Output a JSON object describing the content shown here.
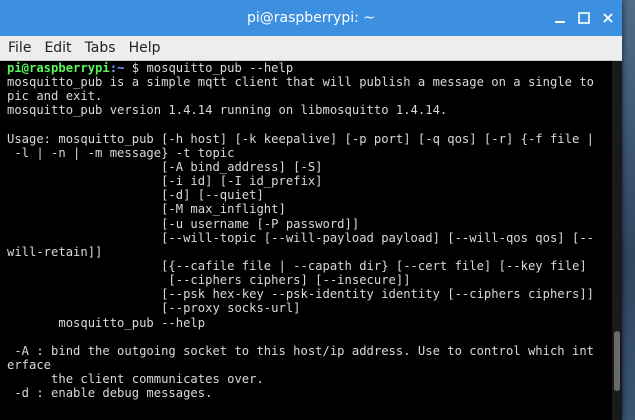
{
  "window": {
    "title": "pi@raspberrypi: ~"
  },
  "menu": {
    "items": [
      "File",
      "Edit",
      "Tabs",
      "Help"
    ]
  },
  "terminal": {
    "prompt": {
      "user_host": "pi@raspberrypi",
      "path": ":~",
      "symbol": " $ ",
      "command": "mosquitto_pub --help"
    },
    "lines": [
      "mosquitto_pub is a simple mqtt client that will publish a message on a single to",
      "pic and exit.",
      "mosquitto_pub version 1.4.14 running on libmosquitto 1.4.14.",
      "",
      "Usage: mosquitto_pub [-h host] [-k keepalive] [-p port] [-q qos] [-r] {-f file |",
      " -l | -n | -m message} -t topic",
      "                     [-A bind_address] [-S]",
      "                     [-i id] [-I id_prefix]",
      "                     [-d] [--quiet]",
      "                     [-M max_inflight]",
      "                     [-u username [-P password]]",
      "                     [--will-topic [--will-payload payload] [--will-qos qos] [--",
      "will-retain]]",
      "                     [{--cafile file | --capath dir} [--cert file] [--key file]",
      "                      [--ciphers ciphers] [--insecure]]",
      "                     [--psk hex-key --psk-identity identity [--ciphers ciphers]]",
      "                     [--proxy socks-url]",
      "       mosquitto_pub --help",
      "",
      " -A : bind the outgoing socket to this host/ip address. Use to control which int",
      "erface",
      "      the client communicates over.",
      " -d : enable debug messages."
    ]
  },
  "colors": {
    "titlebar": "#3d8fe0",
    "terminal_bg": "#000000",
    "terminal_fg": "#d9d9d9",
    "prompt_user": "#5af85a",
    "prompt_path": "#7aa0ff"
  },
  "icons": {
    "minimize": "minimize-icon",
    "maximize": "maximize-icon",
    "close": "close-icon"
  }
}
